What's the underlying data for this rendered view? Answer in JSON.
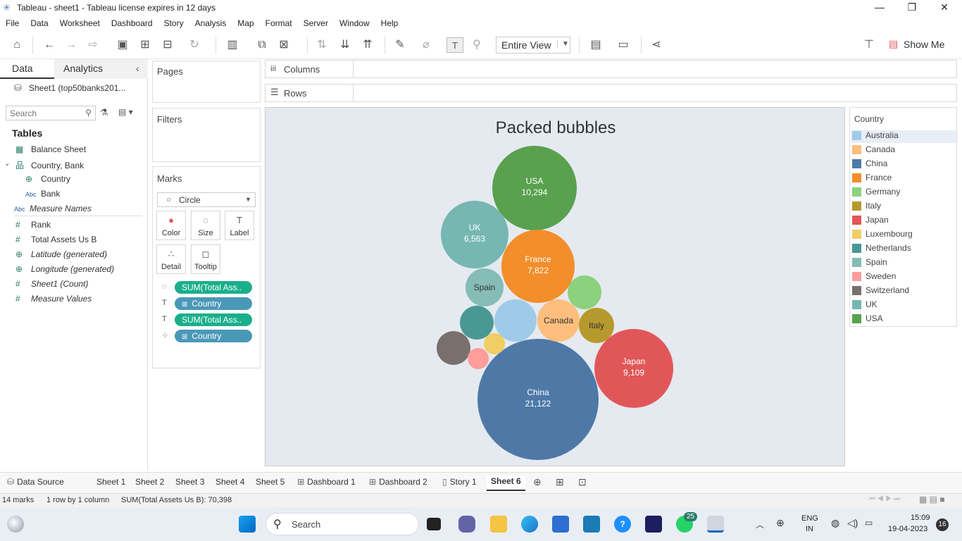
{
  "window": {
    "title": "Tableau - sheet1 - Tableau license expires in 12 days"
  },
  "menu": [
    "File",
    "Data",
    "Worksheet",
    "Dashboard",
    "Story",
    "Analysis",
    "Map",
    "Format",
    "Server",
    "Window",
    "Help"
  ],
  "toolbar": {
    "view_fit": "Entire View",
    "show_me": "Show Me"
  },
  "left": {
    "tab_data": "Data",
    "tab_analytics": "Analytics",
    "datasource": "Sheet1 (top50banks201...",
    "search_placeholder": "Search",
    "tables_header": "Tables",
    "fields": [
      {
        "icon": "table-icon",
        "glyph": "▦",
        "label": "Balance Sheet",
        "italic": false
      },
      {
        "icon": "hierarchy-icon",
        "glyph": "品",
        "label": "Country, Bank",
        "italic": false
      },
      {
        "icon": "globe-icon",
        "glyph": "⊕",
        "label": "Country",
        "italic": false
      },
      {
        "icon": "abc-icon",
        "glyph": "Abc",
        "label": "Bank",
        "italic": false
      },
      {
        "icon": "abc-icon",
        "glyph": "Abc",
        "label": "Measure Names",
        "italic": true
      },
      {
        "icon": "hash-icon",
        "glyph": "#",
        "label": "Rank",
        "italic": false
      },
      {
        "icon": "hash-icon",
        "glyph": "#",
        "label": "Total Assets Us B",
        "italic": false
      },
      {
        "icon": "globe-icon",
        "glyph": "⊕",
        "label": "Latitude (generated)",
        "italic": true
      },
      {
        "icon": "globe-icon",
        "glyph": "⊕",
        "label": "Longitude (generated)",
        "italic": true
      },
      {
        "icon": "hash-icon",
        "glyph": "#",
        "label": "Sheet1 (Count)",
        "italic": true
      },
      {
        "icon": "hash-icon",
        "glyph": "#",
        "label": "Measure Values",
        "italic": true
      }
    ]
  },
  "cards": {
    "pages": "Pages",
    "filters": "Filters",
    "marks": "Marks",
    "mark_type": "Circle",
    "buttons": [
      "Color",
      "Size",
      "Label",
      "Detail",
      "Tooltip"
    ],
    "pills": [
      {
        "label": "SUM(Total Ass..",
        "color": "#1aaf8b"
      },
      {
        "label": "Country",
        "color": "#4a98b8",
        "plus": true
      },
      {
        "label": "SUM(Total Ass..",
        "color": "#1aaf8b"
      },
      {
        "label": "Country",
        "color": "#4a98b8",
        "plus": true
      }
    ]
  },
  "shelves": {
    "columns": "Columns",
    "rows": "Rows"
  },
  "chart_data": {
    "type": "bubble",
    "title": "Packed bubbles",
    "measure": "SUM(Total Assets Us B)",
    "bubbles": [
      {
        "name": "China",
        "value": 21122,
        "label": "China",
        "value_label": "21,122",
        "color": "#4e79a7"
      },
      {
        "name": "USA",
        "value": 10294,
        "label": "USA",
        "value_label": "10,294",
        "color": "#59a14f"
      },
      {
        "name": "Japan",
        "value": 9109,
        "label": "Japan",
        "value_label": "9,109",
        "color": "#e15759"
      },
      {
        "name": "France",
        "value": 7822,
        "label": "France",
        "value_label": "7,822",
        "color": "#f28e2b"
      },
      {
        "name": "UK",
        "value": 6563,
        "label": "UK",
        "value_label": "6,563",
        "color": "#76b7b2"
      },
      {
        "name": "Spain",
        "label": "Spain",
        "value_label": "",
        "color": "#86bcb6"
      },
      {
        "name": "Canada",
        "label": "Canada",
        "value_label": "",
        "color": "#ffbe7d"
      },
      {
        "name": "Italy",
        "label": "Italy",
        "value_label": "",
        "color": "#b6992d"
      },
      {
        "name": "Australia",
        "label": "",
        "value_label": "",
        "color": "#a0cbe8"
      },
      {
        "name": "Germany",
        "label": "",
        "value_label": "",
        "color": "#8cd17d"
      },
      {
        "name": "Netherlands",
        "label": "",
        "value_label": "",
        "color": "#499894"
      },
      {
        "name": "Switzerland",
        "label": "",
        "value_label": "",
        "color": "#79706e"
      },
      {
        "name": "Luxembourg",
        "label": "",
        "value_label": "",
        "color": "#f1ce63"
      },
      {
        "name": "Sweden",
        "label": "",
        "value_label": "",
        "color": "#ff9d9a"
      }
    ],
    "legend": {
      "title": "Country",
      "placement": "right",
      "items": [
        {
          "name": "Australia",
          "color": "#a0cbe8"
        },
        {
          "name": "Canada",
          "color": "#ffbe7d"
        },
        {
          "name": "China",
          "color": "#4e79a7"
        },
        {
          "name": "France",
          "color": "#f28e2b"
        },
        {
          "name": "Germany",
          "color": "#8cd17d"
        },
        {
          "name": "Italy",
          "color": "#b6992d"
        },
        {
          "name": "Japan",
          "color": "#e15759"
        },
        {
          "name": "Luxembourg",
          "color": "#f1ce63"
        },
        {
          "name": "Netherlands",
          "color": "#499894"
        },
        {
          "name": "Spain",
          "color": "#86bcb6"
        },
        {
          "name": "Sweden",
          "color": "#ff9d9a"
        },
        {
          "name": "Switzerland",
          "color": "#79706e"
        },
        {
          "name": "UK",
          "color": "#76b7b2"
        },
        {
          "name": "USA",
          "color": "#59a14f"
        }
      ]
    }
  },
  "sheet_tabs": [
    {
      "label": "Data Source",
      "icon": "database-icon"
    },
    {
      "label": "Sheet 1"
    },
    {
      "label": "Sheet 2"
    },
    {
      "label": "Sheet 3"
    },
    {
      "label": "Sheet 4"
    },
    {
      "label": "Sheet 5"
    },
    {
      "label": "Dashboard 1",
      "icon": "dashboard-icon"
    },
    {
      "label": "Dashboard 2",
      "icon": "dashboard-icon"
    },
    {
      "label": "Story 1",
      "icon": "story-icon"
    },
    {
      "label": "Sheet 6",
      "active": true
    }
  ],
  "status": {
    "marks": "14 marks",
    "dims": "1 row by 1 column",
    "sum": "SUM(Total Assets Us B): 70,398"
  },
  "taskbar": {
    "search": "Search",
    "whatsapp_badge": "25",
    "lang1": "ENG",
    "lang2": "IN",
    "time": "15:09",
    "date": "19-04-2023",
    "notif": "16"
  }
}
